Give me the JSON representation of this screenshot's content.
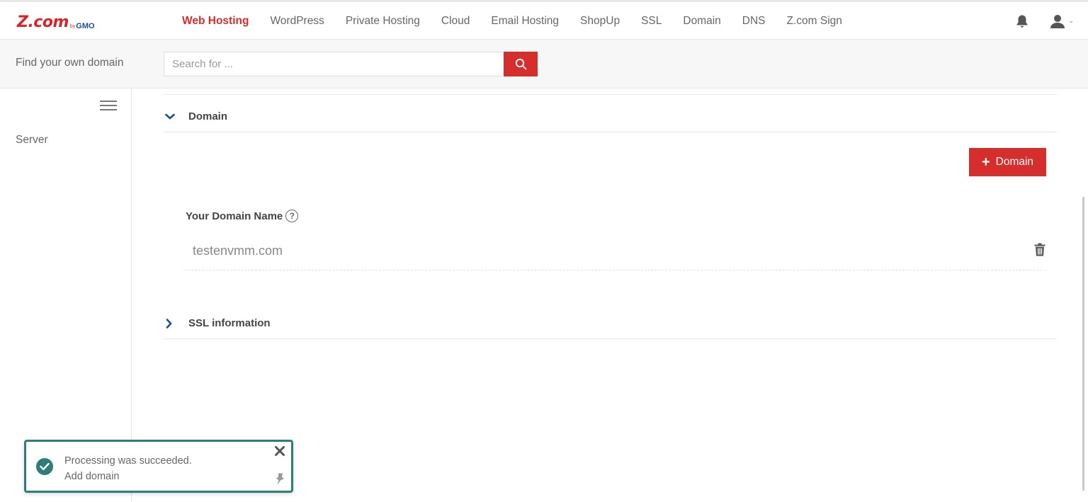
{
  "brand": {
    "logo_main": "Z.com",
    "logo_by": "by",
    "logo_gmo": "GMO"
  },
  "nav": {
    "items": [
      {
        "label": "Web Hosting",
        "active": true
      },
      {
        "label": "WordPress"
      },
      {
        "label": "Private Hosting"
      },
      {
        "label": "Cloud"
      },
      {
        "label": "Email Hosting"
      },
      {
        "label": "ShopUp"
      },
      {
        "label": "SSL"
      },
      {
        "label": "Domain"
      },
      {
        "label": "DNS"
      },
      {
        "label": "Z.com Sign"
      }
    ]
  },
  "header_icons": {
    "notifications": "bell-icon",
    "user": "user-icon",
    "user_caret": "chevron-down-icon"
  },
  "search": {
    "label": "Find your own domain",
    "placeholder": "Search for ...",
    "value": "",
    "button_icon": "search-icon"
  },
  "sidebar": {
    "items": [
      {
        "label": "Server"
      }
    ]
  },
  "domain_section": {
    "title": "Domain",
    "expanded": true,
    "add_button_label": "Domain",
    "field_label": "Your Domain Name",
    "help_glyph": "?",
    "domains": [
      "testenvmm.com"
    ]
  },
  "ssl_section": {
    "title": "SSL information",
    "expanded": false
  },
  "toast": {
    "line1": "Processing was succeeded.",
    "line2": "Add domain"
  },
  "colors": {
    "accent": "#d62d2d",
    "toast": "#2e7d78",
    "chevron": "#1b4f9c"
  }
}
